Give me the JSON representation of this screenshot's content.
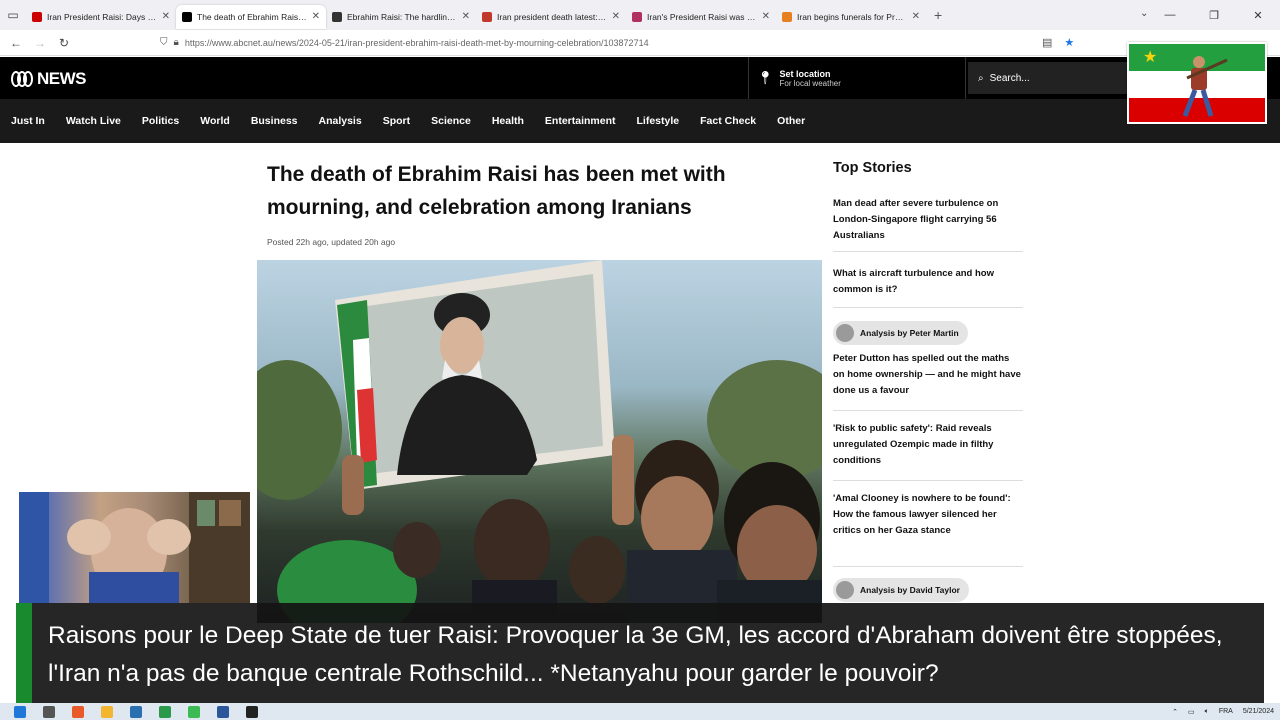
{
  "browser": {
    "tabs": [
      {
        "label": "Iran President Raisi: Days of fun",
        "fav_color": "#cc0000",
        "active": false
      },
      {
        "label": "The death of Ebrahim Raisi has",
        "fav_color": "#000000",
        "active": true
      },
      {
        "label": "Ebrahim Raisi: The hardline cle",
        "fav_color": "#333333",
        "active": false
      },
      {
        "label": "Iran president death latest: Ebra",
        "fav_color": "#c0392b",
        "active": false
      },
      {
        "label": "Iran's President Raisi was know",
        "fav_color": "#b03060",
        "active": false
      },
      {
        "label": "Iran begins funerals for Preside",
        "fav_color": "#e67e22",
        "active": false
      }
    ],
    "url": "https://www.abcnet.au/news/2024-05-21/iran-president-ebrahim-raisi-death-met-by-mourning-celebration/103872714"
  },
  "header": {
    "logo": "NEWS",
    "location_title": "Set location",
    "location_sub": "For local weather",
    "search_placeholder": "Search..."
  },
  "nav": [
    "Just In",
    "Watch Live",
    "Politics",
    "World",
    "Business",
    "Analysis",
    "Sport",
    "Science",
    "Health",
    "Entertainment",
    "Lifestyle",
    "Fact Check",
    "Other"
  ],
  "article": {
    "headline": "The death of Ebrahim Raisi has been met with mourning, and celebration among Iranians",
    "posted": "Posted 22h ago, updated 20h ago"
  },
  "top_stories": {
    "title": "Top Stories",
    "items": [
      "Man dead after severe turbulence on London-Singapore flight carrying 56 Australians",
      "What is aircraft turbulence and how common is it?",
      "Peter Dutton has spelled out the maths on home ownership — and he might have done us a favour",
      "'Risk to public safety': Raid reveals unregulated Ozempic made in filthy conditions",
      "'Amal Clooney is nowhere to be found': How the famous lawyer silenced her critics on her Gaza stance"
    ],
    "analysis_1": "Analysis by Peter Martin",
    "analysis_2": "Analysis by David Taylor"
  },
  "caption": {
    "text": "Raisons pour le Deep State de tuer Raisi: Provoquer la 3e GM, les accord d'Abraham doivent être stoppées, l'Iran n'a pas de banque centrale Rothschild... *Netanyahu pour garder le pouvoir?",
    "accent": "#1a8a2e"
  },
  "taskbar": {
    "lang": "FRA",
    "date": "5/21/2024"
  },
  "colors": {
    "abc_black": "#000000",
    "nav_bg": "#1a1a1a",
    "flag_green": "#239f40",
    "flag_red": "#da0000"
  }
}
